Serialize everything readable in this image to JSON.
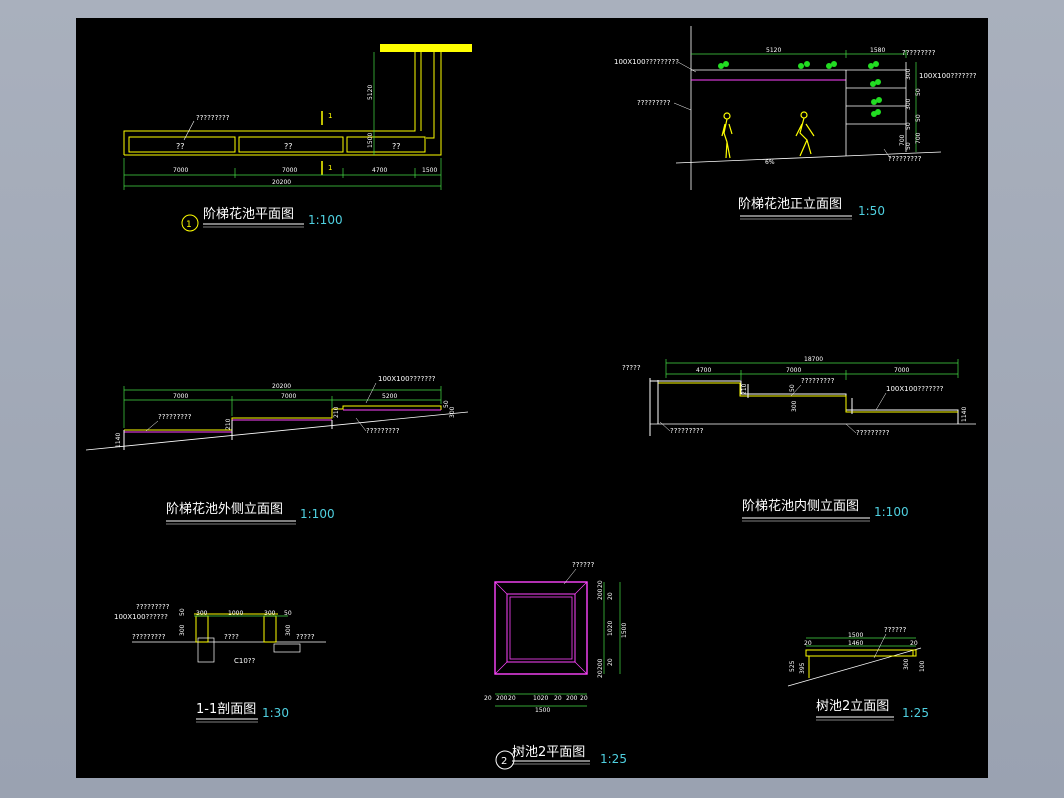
{
  "titles": {
    "plan": "阶梯花池平面图",
    "front": "阶梯花池正立面图",
    "outer": "阶梯花池外侧立面图",
    "inner": "阶梯花池内侧立面图",
    "section": "1-1剖面图",
    "treepit_plan": "树池2平面图",
    "treepit_elev": "树池2立面图"
  },
  "scales": {
    "plan": "1:100",
    "front": "1:50",
    "outer": "1:100",
    "inner": "1:100",
    "section": "1:30",
    "treepit_plan": "1:25",
    "treepit_elev": "1:25"
  },
  "detail_markers": {
    "plan": "1",
    "treepit_plan": "2"
  },
  "plan": {
    "dims": [
      "7000",
      "7000",
      "4700",
      "1500"
    ],
    "total": "20200",
    "vert_dims": [
      "5120",
      "1500"
    ],
    "cells": [
      "??",
      "??",
      "??"
    ],
    "note": "?????????",
    "cut_marks": [
      "1",
      "1"
    ]
  },
  "front": {
    "top_dims": [
      "5120",
      "1580"
    ],
    "notes": [
      "100X100?????????",
      "?????????",
      "100X100???????",
      "?????????",
      "?????????"
    ],
    "side_dims": [
      "300",
      "50",
      "300",
      "50",
      "50",
      "700",
      "50",
      "700"
    ],
    "slope": "6%"
  },
  "outer": {
    "dims": [
      "7000",
      "7000",
      "5200"
    ],
    "total": "20200",
    "notes": [
      "100X100???????",
      "?????????",
      "?????????"
    ],
    "heights": [
      "1140",
      "210",
      "210",
      "50",
      "300"
    ]
  },
  "inner": {
    "top_total": "18700",
    "dims": [
      "4700",
      "7000",
      "7000"
    ],
    "notes": [
      "?????",
      "?????????",
      "100X100???????",
      "?????????",
      "?????????"
    ],
    "heights": [
      "210",
      "50",
      "300",
      "1140"
    ]
  },
  "section": {
    "dims": [
      "300",
      "1000",
      "300",
      "50"
    ],
    "notes": [
      "?????????",
      "100X100??????",
      "?????????",
      "????",
      "?????",
      "C10??"
    ],
    "heights": [
      "50",
      "300",
      "300"
    ]
  },
  "treepit_plan": {
    "note": "??????",
    "bottom_dims": [
      "20",
      "200",
      "20",
      "1020",
      "20",
      "200",
      "20"
    ],
    "total": "1500",
    "side_dims": [
      "20",
      "200",
      "20",
      "1020",
      "20",
      "200",
      "20",
      "1500"
    ]
  },
  "treepit_elev": {
    "dims": [
      "1500",
      "20",
      "1460",
      "20"
    ],
    "note": "??????",
    "heights": [
      "525",
      "395",
      "300",
      "100"
    ]
  }
}
